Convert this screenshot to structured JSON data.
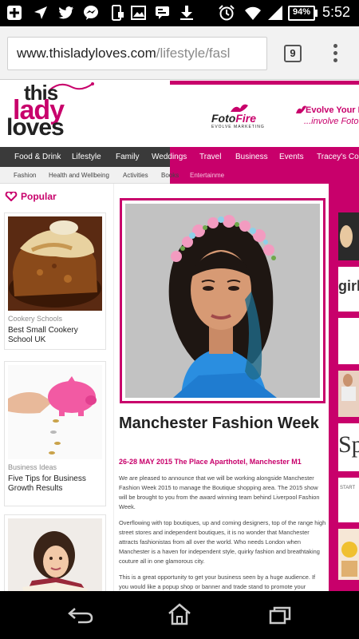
{
  "status_bar": {
    "battery": "94%",
    "time": "5:52",
    "icons": [
      "plus-icon",
      "location-icon",
      "twitter-icon",
      "messenger-icon",
      "phone-sync-icon",
      "image-icon",
      "chat-icon",
      "download-icon",
      "alarm-icon",
      "wifi-icon",
      "signal-icon",
      "battery-icon"
    ]
  },
  "browser": {
    "url_main": "www.thisladyloves.com",
    "url_rest": "/lifestyle/fasl",
    "tab_count": "9"
  },
  "site": {
    "logo": {
      "line1": "this",
      "line2": "lady",
      "line3": "loves"
    },
    "banner": {
      "brand_a": "Foto",
      "brand_b": "Fire",
      "brand_sub": "EVOLVE MARKETING",
      "tagline_1": "Evolve Your I",
      "tagline_2": "...involve Foto"
    },
    "main_nav": [
      "Food & Drink",
      "Lifestyle",
      "Family",
      "Weddings",
      "Travel",
      "Business",
      "Events",
      "Tracey's Colu"
    ],
    "sub_nav": [
      "Fashion",
      "Health and Wellbeing",
      "Activities",
      "Books",
      "Entertainme"
    ]
  },
  "sidebar": {
    "heading": "Popular",
    "cards": [
      {
        "category": "Cookery Schools",
        "title": "Best Small Cookery School UK"
      },
      {
        "category": "Business Ideas",
        "title": "Five Tips for Business Growth Results"
      },
      {
        "category": "",
        "title": ""
      }
    ]
  },
  "article": {
    "title": "Manchester Fashion Week",
    "date_line": "26-28 MAY 2015 The Place Aparthotel, Manchester M1",
    "paragraphs": [
      "We are pleased to announce that we will be working alongside Manchester Fashion Week 2015 to manage the Boutique shopping area. The 2015 show will be brought to you from the award winning team behind Liverpool Fashion Week.",
      "Overflowing with top boutiques, up and coming designers, top of the range high street stores and independent boutiques, it is no wonder that Manchester attracts fashionistas from all over the world. Who needs London when Manchester is a haven for independent style, quirky fashion and breathtaking couture all in one glamorous city.",
      "This is a great opportunity to get your business seen by a huge audience. If you would like a popup shop or banner and trade stand to promote your"
    ]
  },
  "right_column": {
    "thumb_texts": [
      "",
      "girl",
      "",
      "",
      "Sp",
      "START",
      ""
    ]
  },
  "colors": {
    "brand_pink": "#c8006b",
    "nav_dark": "#3a3a3a"
  }
}
